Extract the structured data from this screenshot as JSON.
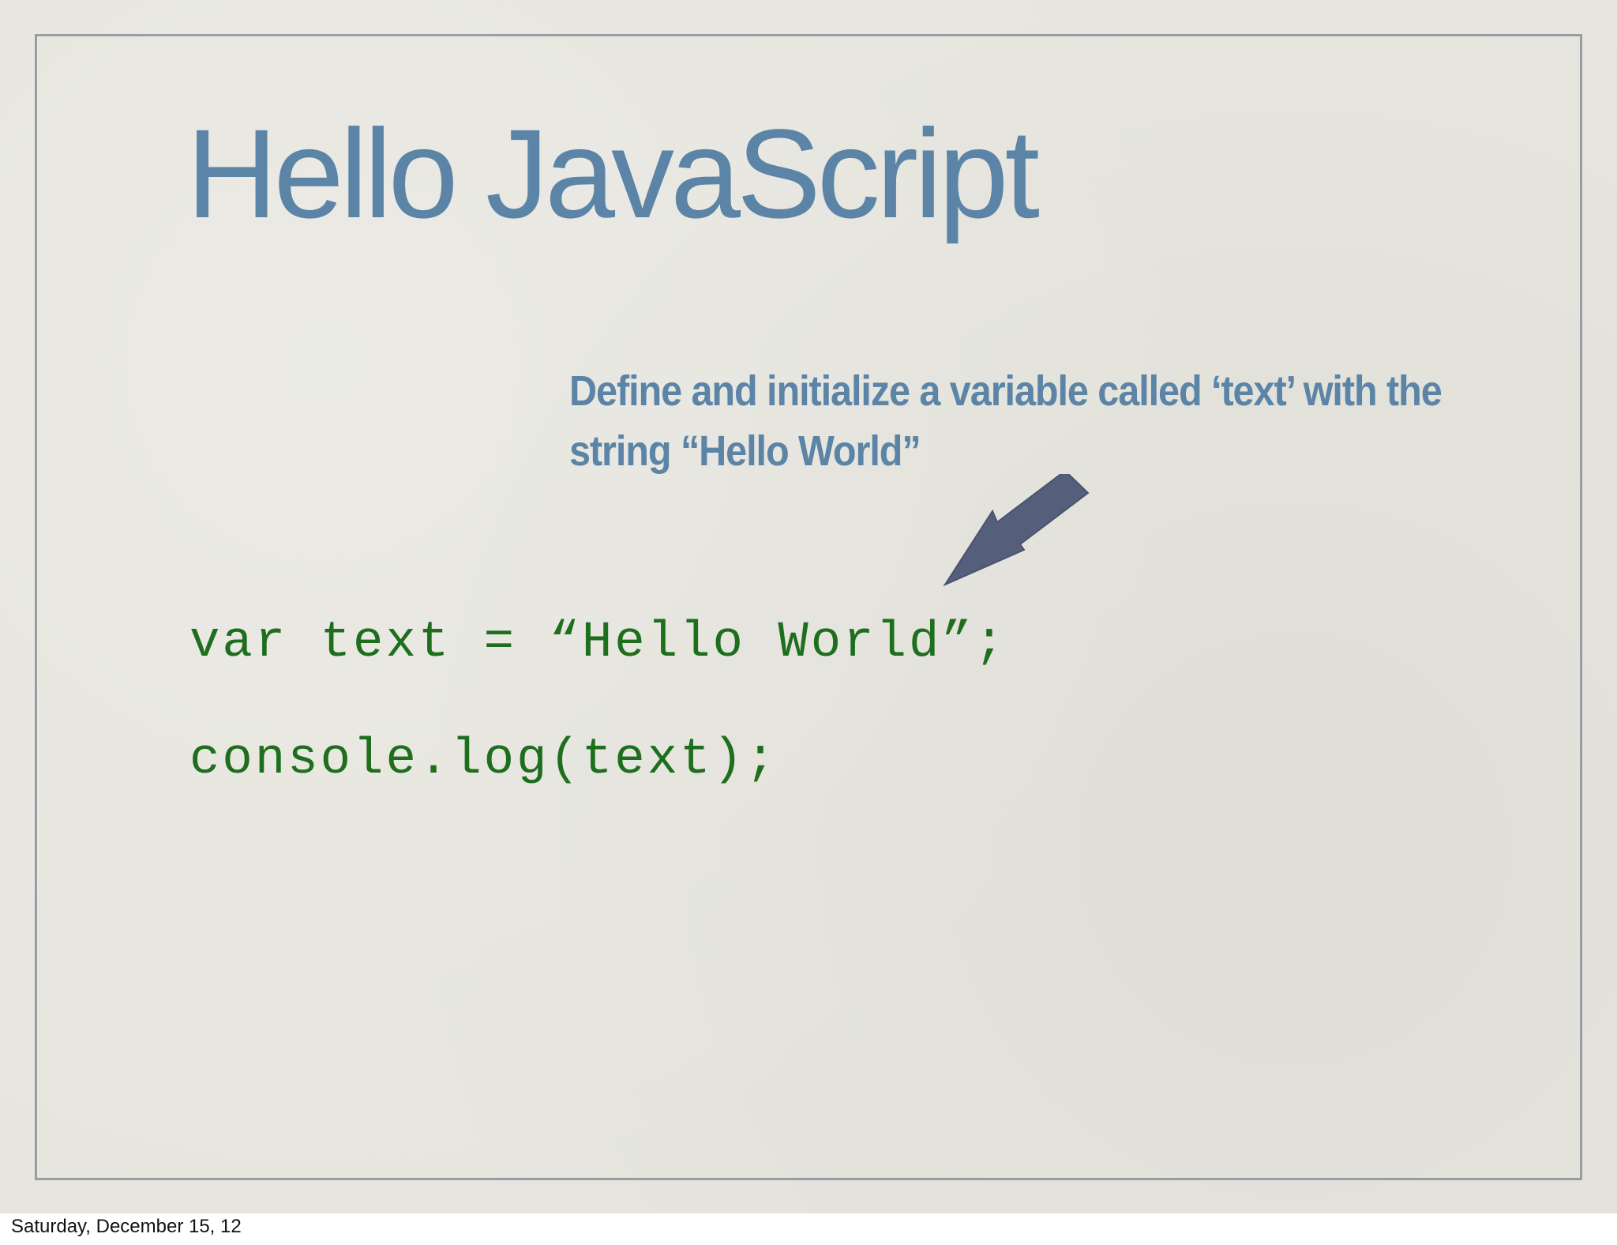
{
  "slide": {
    "title": "Hello JavaScript",
    "callout": "Define and initialize a variable called ‘text’ with the string “Hello World”",
    "code_lines": [
      "var text = “Hello World”;",
      "console.log(text);"
    ],
    "arrow_icon": "arrow-down-left-icon"
  },
  "footer": {
    "date": "Saturday, December 15, 12"
  },
  "colors": {
    "background": "#e6e5de",
    "title": "#5b84a6",
    "callout": "#5b84a6",
    "code": "#1d6e1d",
    "arrow": "#555e7a",
    "frame": "#9a9ca3"
  }
}
